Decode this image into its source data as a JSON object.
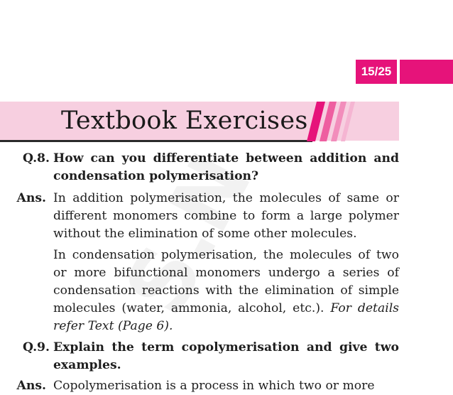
{
  "header": {
    "page_badge": "15/25",
    "section_title": "Textbook Exercises",
    "accent_color": "#e6137a",
    "band_color": "#f7cfe0"
  },
  "watermark": {
    "text": "S.N"
  },
  "content": {
    "q8": {
      "label": "Q.8.",
      "text": "How can you differentiate between addition and condensation polymerisation?"
    },
    "a8": {
      "label": "Ans.",
      "para1": "In addition polymerisation, the molecules of same or different monomers combine to form a large polymer without the elimination of some other molecules.",
      "para2": "In condensation polymerisation, the molecules of two or more bifunctional monomers undergo a series of condensation reactions with the elimination of simple molecules (water, ammonia, alcohol, etc.).",
      "para2_ref": "For details refer Text (Page 6)."
    },
    "q9": {
      "label": "Q.9.",
      "text": "Explain the term copolymerisation and give two examples."
    },
    "a9": {
      "label": "Ans.",
      "text": "Copolymerisation is a process in which two or more"
    }
  }
}
